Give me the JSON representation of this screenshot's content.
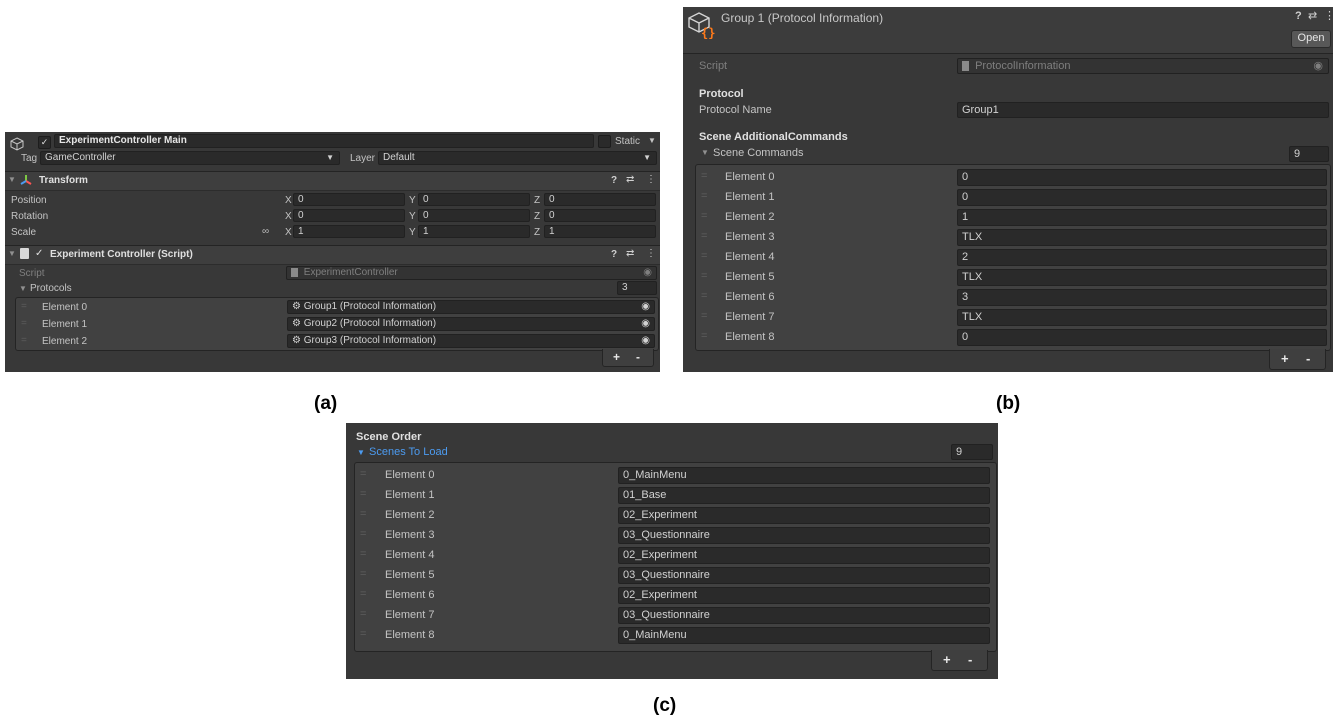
{
  "panel_a": {
    "object_name": "ExperimentController Main",
    "static_label": "Static",
    "tag_label": "Tag",
    "tag_value": "GameController",
    "layer_label": "Layer",
    "layer_value": "Default",
    "transform": {
      "title": "Transform",
      "rows": [
        {
          "label": "Position",
          "x": "0",
          "y": "0",
          "z": "0"
        },
        {
          "label": "Rotation",
          "x": "0",
          "y": "0",
          "z": "0"
        },
        {
          "label": "Scale",
          "x": "1",
          "y": "1",
          "z": "1"
        }
      ],
      "axis_x": "X",
      "axis_y": "Y",
      "axis_z": "Z"
    },
    "component": {
      "title": "Experiment Controller (Script)",
      "script_label": "Script",
      "script_value": "ExperimentController",
      "protocols_label": "Protocols",
      "protocols_count": "3",
      "elements": [
        {
          "label": "Element 0",
          "value": "Group1 (Protocol Information)"
        },
        {
          "label": "Element 1",
          "value": "Group2 (Protocol Information)"
        },
        {
          "label": "Element 2",
          "value": "Group3 (Protocol Information)"
        }
      ]
    },
    "plus": "+",
    "minus": "-"
  },
  "panel_b": {
    "title": "Group 1 (Protocol Information)",
    "open_button": "Open",
    "script_label": "Script",
    "script_value": "ProtocolInformation",
    "protocol_header": "Protocol",
    "protocol_name_label": "Protocol Name",
    "protocol_name_value": "Group1",
    "scene_header": "Scene AdditionalCommands",
    "scene_commands_label": "Scene Commands",
    "scene_commands_count": "9",
    "elements": [
      {
        "label": "Element 0",
        "value": "0"
      },
      {
        "label": "Element 1",
        "value": "0"
      },
      {
        "label": "Element 2",
        "value": "1"
      },
      {
        "label": "Element 3",
        "value": "TLX"
      },
      {
        "label": "Element 4",
        "value": "2"
      },
      {
        "label": "Element 5",
        "value": "TLX"
      },
      {
        "label": "Element 6",
        "value": "3"
      },
      {
        "label": "Element 7",
        "value": "TLX"
      },
      {
        "label": "Element 8",
        "value": "0"
      }
    ],
    "plus": "+",
    "minus": "-"
  },
  "panel_c": {
    "header": "Scene Order",
    "list_label": "Scenes To Load",
    "count": "9",
    "elements": [
      {
        "label": "Element 0",
        "value": "0_MainMenu"
      },
      {
        "label": "Element 1",
        "value": "01_Base"
      },
      {
        "label": "Element 2",
        "value": "02_Experiment"
      },
      {
        "label": "Element 3",
        "value": "03_Questionnaire"
      },
      {
        "label": "Element 4",
        "value": "02_Experiment"
      },
      {
        "label": "Element 5",
        "value": "03_Questionnaire"
      },
      {
        "label": "Element 6",
        "value": "02_Experiment"
      },
      {
        "label": "Element 7",
        "value": "03_Questionnaire"
      },
      {
        "label": "Element 8",
        "value": "0_MainMenu"
      }
    ],
    "plus": "+",
    "minus": "-"
  },
  "captions": {
    "a": "(a)",
    "b": "(b)",
    "c": "(c)"
  },
  "icons": [
    "gameobject-icon",
    "checkbox-icon",
    "dropdown-arrow-icon",
    "transform-icon",
    "script-icon",
    "help-icon",
    "settings-icon",
    "more-icon",
    "object-picker-icon",
    "link-icon",
    "drag-handle-icon",
    "foldout-triangle-icon",
    "scriptable-object-icon"
  ],
  "colors": {
    "panel": "#383838",
    "field": "#2a2a2a",
    "accent_blue": "#4c9bf0",
    "script_orange": "#ff7a1a"
  }
}
